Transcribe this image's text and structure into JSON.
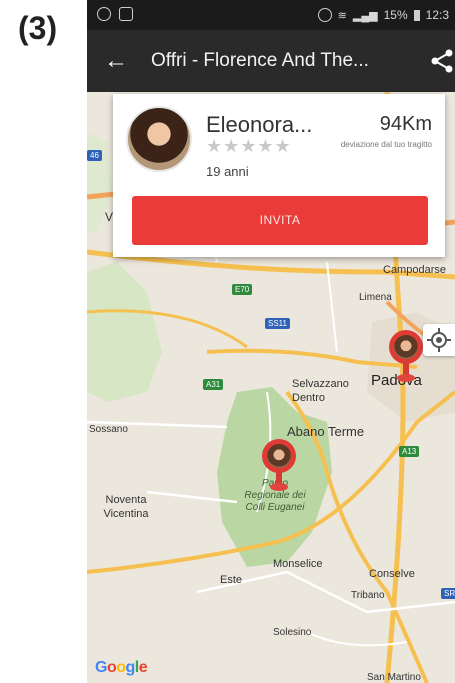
{
  "figure_label": "(3)",
  "status_bar": {
    "battery": "15%",
    "time": "12:3"
  },
  "app_bar": {
    "title": "Offri - Florence And The..."
  },
  "card": {
    "name": "Eleonora...",
    "rating_stars": "★★★★★",
    "age": "19 anni",
    "distance": "94Km",
    "deviation_label": "deviazione dal tuo tragitto",
    "invite_label": "INVITA"
  },
  "map": {
    "labels": {
      "campodarsego": "Campodarse",
      "limena": "Limena",
      "padova": "Padova",
      "selvazzano": "Selvazzano\nDentro",
      "abano": "Abano Terme",
      "sossano": "Sossano",
      "noventa": "Noventa\nVicentina",
      "park": "Parco\nRegionale dei\nColli Euganei",
      "monselice": "Monselice",
      "conselve": "Conselve",
      "este": "Este",
      "tribano": "Tribano",
      "solesino": "Solesino",
      "san_martino": "San Martino",
      "vi": "Vi"
    },
    "shields": {
      "e70": "E70",
      "ss11": "SS11",
      "a31": "A31",
      "a13": "A13",
      "sr": "SR",
      "s46": "46"
    },
    "google": "Google"
  },
  "colors": {
    "accent": "#ea3b38",
    "appbar": "#2a2a2a",
    "park": "#b9d6a3",
    "road": "#f6c050"
  }
}
